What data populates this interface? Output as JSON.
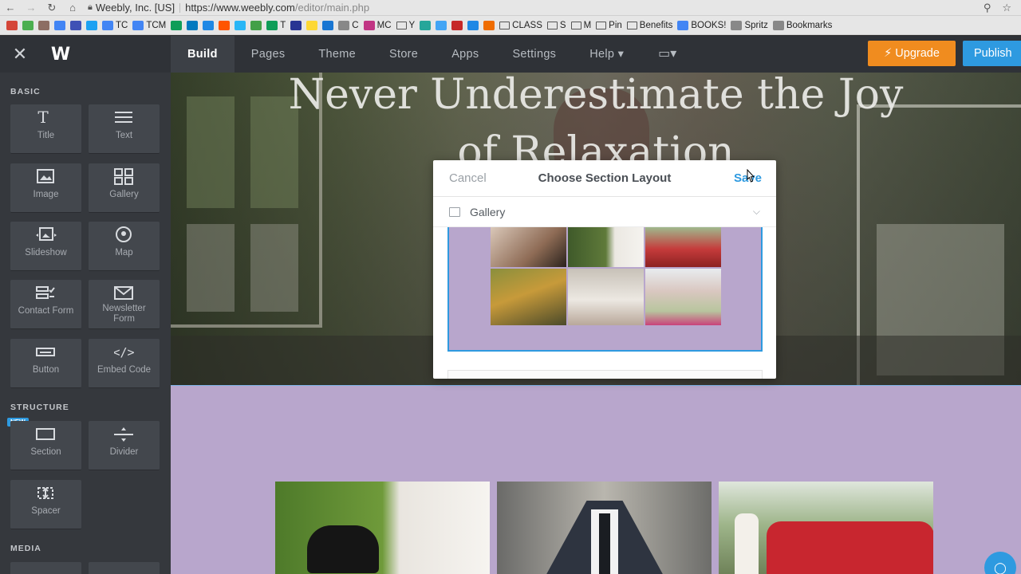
{
  "browser": {
    "site_identity": "Weebly, Inc. [US]",
    "url_host": "https://www.weebly.com",
    "url_path": "/editor/main.php",
    "bookmarks": [
      {
        "label": "",
        "icon": "gmail-icon",
        "color": "#d44638"
      },
      {
        "label": "",
        "icon": "green-icon",
        "color": "#4caf50"
      },
      {
        "label": "",
        "icon": "p-icon",
        "color": "#8d6e63"
      },
      {
        "label": "",
        "icon": "doc-icon",
        "color": "#4285f4"
      },
      {
        "label": "",
        "icon": "calendar-icon",
        "color": "#3f51b5"
      },
      {
        "label": "",
        "icon": "twitter-icon",
        "color": "#1da1f2"
      },
      {
        "label": "TC",
        "icon": "doc-icon",
        "color": "#4285f4"
      },
      {
        "label": "TCM",
        "icon": "doc-icon",
        "color": "#4285f4"
      },
      {
        "label": "",
        "icon": "sheets-icon",
        "color": "#0f9d58"
      },
      {
        "label": "",
        "icon": "trello-icon",
        "color": "#0079bf"
      },
      {
        "label": "",
        "icon": "drive-icon",
        "color": "#1e88e5"
      },
      {
        "label": "",
        "icon": "soundcloud-icon",
        "color": "#ff5500"
      },
      {
        "label": "",
        "icon": "check-icon",
        "color": "#29b6f6"
      },
      {
        "label": "",
        "icon": "leaf-icon",
        "color": "#43a047"
      },
      {
        "label": "T",
        "icon": "sheets-icon",
        "color": "#0f9d58"
      },
      {
        "label": "",
        "icon": "circle-icon",
        "color": "#283593"
      },
      {
        "label": "",
        "icon": "pacman-icon",
        "color": "#fdd835"
      },
      {
        "label": "",
        "icon": "p-icon",
        "color": "#1976d2"
      },
      {
        "label": "C",
        "icon": "page-icon",
        "color": "#888888"
      },
      {
        "label": "MC",
        "icon": "instagram-icon",
        "color": "#c13584"
      },
      {
        "label": "Y",
        "icon": "folder-icon",
        "color": "#555555"
      },
      {
        "label": "",
        "icon": "g-icon",
        "color": "#26a69a"
      },
      {
        "label": "",
        "icon": "globe-icon",
        "color": "#42a5f5"
      },
      {
        "label": "",
        "icon": "calendar-icon",
        "color": "#c62828"
      },
      {
        "label": "",
        "icon": "star-icon",
        "color": "#1e88e5"
      },
      {
        "label": "",
        "icon": "bookmark-icon",
        "color": "#ef6c00"
      },
      {
        "label": "CLASS",
        "icon": "folder-icon",
        "color": "#555555"
      },
      {
        "label": "S",
        "icon": "folder-icon",
        "color": "#555555"
      },
      {
        "label": "M",
        "icon": "folder-icon",
        "color": "#555555"
      },
      {
        "label": "Pin",
        "icon": "folder-icon",
        "color": "#555555"
      },
      {
        "label": "Benefits",
        "icon": "folder-icon",
        "color": "#555555"
      },
      {
        "label": "BOOKS!",
        "icon": "doc-icon",
        "color": "#4285f4"
      },
      {
        "label": "Spritz",
        "icon": "page-icon",
        "color": "#888888"
      },
      {
        "label": "Bookmarks",
        "icon": "bookmarks-icon",
        "color": "#888888"
      }
    ]
  },
  "header": {
    "tabs": [
      {
        "label": "Build",
        "active": true
      },
      {
        "label": "Pages"
      },
      {
        "label": "Theme"
      },
      {
        "label": "Store"
      },
      {
        "label": "Apps"
      },
      {
        "label": "Settings"
      },
      {
        "label": "Help ▾"
      }
    ],
    "upgrade_label": "Upgrade",
    "publish_label": "Publish"
  },
  "sidebar": {
    "basic_heading": "BASIC",
    "structure_heading": "STRUCTURE",
    "media_heading": "MEDIA",
    "new_badge": "NEW",
    "tiles": [
      {
        "label": "Title",
        "icon": "title-icon"
      },
      {
        "label": "Text",
        "icon": "text-icon"
      },
      {
        "label": "Image",
        "icon": "image-icon"
      },
      {
        "label": "Gallery",
        "icon": "gallery-icon"
      },
      {
        "label": "Slideshow",
        "icon": "slideshow-icon"
      },
      {
        "label": "Map",
        "icon": "map-icon"
      },
      {
        "label": "Contact Form",
        "icon": "contact-form-icon"
      },
      {
        "label": "Newsletter Form",
        "icon": "newsletter-icon"
      },
      {
        "label": "Button",
        "icon": "button-icon"
      },
      {
        "label": "Embed Code",
        "icon": "embed-code-icon"
      },
      {
        "label": "Section",
        "icon": "section-icon"
      },
      {
        "label": "Divider",
        "icon": "divider-icon"
      },
      {
        "label": "Spacer",
        "icon": "spacer-icon"
      }
    ]
  },
  "canvas": {
    "hero_title_line1": "Never Underestimate the  Joy",
    "hero_title_line2": "of Relaxation"
  },
  "modal": {
    "cancel_label": "Cancel",
    "title": "Choose Section Layout",
    "save_label": "Save",
    "select_value": "Gallery"
  },
  "colors": {
    "accent": "#2e9ae0",
    "upgrade": "#f08c1f",
    "section_bg": "#b8a6cc",
    "sidebar_bg": "#35383d",
    "topbar_bg": "#2f3237"
  }
}
